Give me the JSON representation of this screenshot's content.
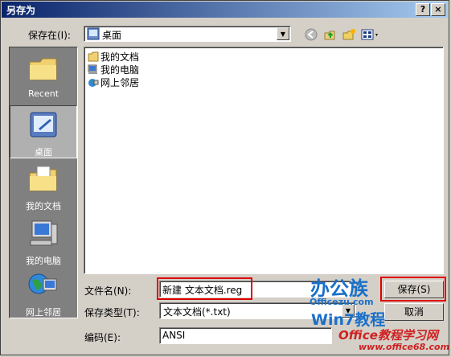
{
  "window": {
    "title": "另存为"
  },
  "title_buttons": {
    "help": "?",
    "close": "×"
  },
  "save_in": {
    "label": "保存在(I):",
    "value": "桌面"
  },
  "places": [
    {
      "label": "Recent"
    },
    {
      "label": "桌面"
    },
    {
      "label": "我的文档"
    },
    {
      "label": "我的电脑"
    },
    {
      "label": "网上邻居"
    }
  ],
  "files": [
    {
      "label": "我的文档"
    },
    {
      "label": "我的电脑"
    },
    {
      "label": "网上邻居"
    }
  ],
  "filename": {
    "label": "文件名(N):",
    "value": "新建 文本文档.reg"
  },
  "filetype": {
    "label": "保存类型(T):",
    "value": "文本文档(*.txt)"
  },
  "encoding": {
    "label": "编码(E):",
    "value": "ANSI"
  },
  "buttons": {
    "save": "保存(S)",
    "cancel": "取消"
  },
  "watermark": {
    "brand1": "办公族",
    "site1": "Officezu.com",
    "brand2": "Win7教程",
    "brand3": "Office教程学习网",
    "site2": "www.office68.com"
  },
  "colors": {
    "highlight": "#e00000",
    "title_start": "#0a246a",
    "title_end": "#a6caf0"
  }
}
